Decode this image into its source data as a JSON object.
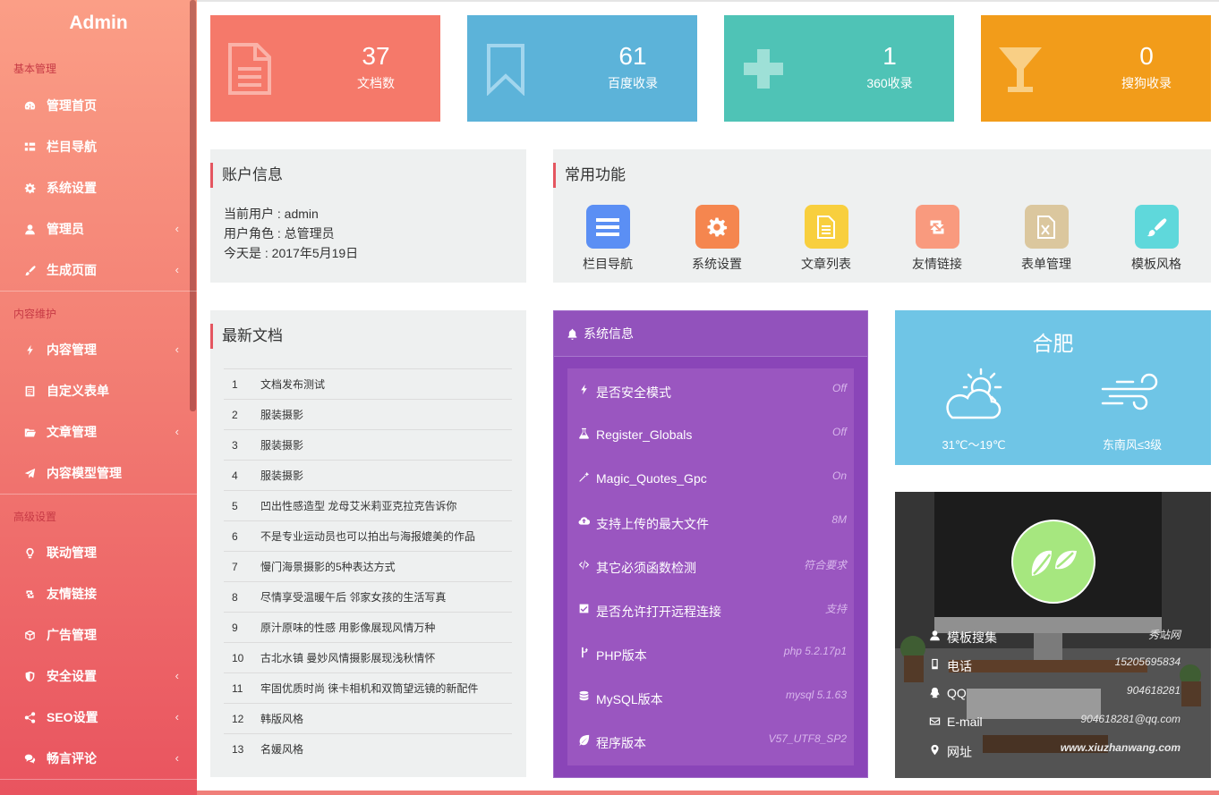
{
  "sidebar": {
    "logo": "Admin",
    "groups": [
      "基本管理",
      "内容维护",
      "高级设置"
    ],
    "items": [
      {
        "label": "管理首页",
        "icon": "dashboard-icon",
        "arrow": ""
      },
      {
        "label": "栏目导航",
        "icon": "list-icon",
        "arrow": ""
      },
      {
        "label": "系统设置",
        "icon": "gear-icon",
        "arrow": ""
      },
      {
        "label": "管理员",
        "icon": "user-icon",
        "arrow": "‹"
      },
      {
        "label": "生成页面",
        "icon": "brush-icon",
        "arrow": "‹"
      },
      {
        "label": "内容管理",
        "icon": "bolt-icon",
        "arrow": "‹"
      },
      {
        "label": "自定义表单",
        "icon": "form-icon",
        "arrow": ""
      },
      {
        "label": "文章管理",
        "icon": "folder-icon",
        "arrow": "‹"
      },
      {
        "label": "内容模型管理",
        "icon": "send-icon",
        "arrow": ""
      },
      {
        "label": "联动管理",
        "icon": "bulb-icon",
        "arrow": ""
      },
      {
        "label": "友情链接",
        "icon": "retweet-icon",
        "arrow": ""
      },
      {
        "label": "广告管理",
        "icon": "cube-icon",
        "arrow": ""
      },
      {
        "label": "安全设置",
        "icon": "shield-icon",
        "arrow": "‹"
      },
      {
        "label": "SEO设置",
        "icon": "share-icon",
        "arrow": "‹"
      },
      {
        "label": "畅言评论",
        "icon": "comments-icon",
        "arrow": "‹"
      }
    ]
  },
  "stats": [
    {
      "value": "37",
      "label": "文档数",
      "color": "#f5796a",
      "icon": "document-icon"
    },
    {
      "value": "61",
      "label": "百度收录",
      "color": "#5cb3d9",
      "icon": "bookmark-icon"
    },
    {
      "value": "1",
      "label": "360收录",
      "color": "#4fc3b6",
      "icon": "plus-icon"
    },
    {
      "value": "0",
      "label": "搜狗收录",
      "color": "#f29c1a",
      "icon": "cocktail-icon"
    }
  ],
  "account": {
    "title": "账户信息",
    "user": "当前用户 : admin",
    "role": "用户角色 : 总管理员",
    "date": "今天是 : 2017年5月19日"
  },
  "quick": {
    "title": "常用功能",
    "items": [
      {
        "label": "栏目导航",
        "color": "#5b8ff4",
        "icon": "list-icon"
      },
      {
        "label": "系统设置",
        "color": "#f5864f",
        "icon": "gear-icon"
      },
      {
        "label": "文章列表",
        "color": "#f8cf3e",
        "icon": "file-icon"
      },
      {
        "label": "友情链接",
        "color": "#f99a7e",
        "icon": "retweet-icon"
      },
      {
        "label": "表单管理",
        "color": "#dbc79e",
        "icon": "excel-icon"
      },
      {
        "label": "模板风格",
        "color": "#5fd8db",
        "icon": "brush-icon"
      }
    ]
  },
  "docs": {
    "title": "最新文档",
    "rows": [
      {
        "n": "1",
        "title": "文档发布测试"
      },
      {
        "n": "2",
        "title": "服装摄影"
      },
      {
        "n": "3",
        "title": "服装摄影"
      },
      {
        "n": "4",
        "title": "服装摄影"
      },
      {
        "n": "5",
        "title": "凹出性感造型 龙母艾米莉亚克拉克告诉你"
      },
      {
        "n": "6",
        "title": "不是专业运动员也可以拍出与海报媲美的作品"
      },
      {
        "n": "7",
        "title": "慢门海景摄影的5种表达方式"
      },
      {
        "n": "8",
        "title": "尽情享受温暖午后 邻家女孩的生活写真"
      },
      {
        "n": "9",
        "title": "原汁原味的性感 用影像展现风情万种"
      },
      {
        "n": "10",
        "title": "古北水镇 曼妙风情摄影展现浅秋情怀"
      },
      {
        "n": "11",
        "title": "牢固优质时尚 徕卡相机和双筒望远镜的新配件"
      },
      {
        "n": "12",
        "title": "韩版风格"
      },
      {
        "n": "13",
        "title": "名媛风格"
      }
    ]
  },
  "sysinfo": {
    "title": "系统信息",
    "items": [
      {
        "label": "是否安全模式",
        "value": "Off",
        "icon": "bolt-icon"
      },
      {
        "label": "Register_Globals",
        "value": "Off",
        "icon": "flask-icon"
      },
      {
        "label": "Magic_Quotes_Gpc",
        "value": "On",
        "icon": "magic-icon"
      },
      {
        "label": "支持上传的最大文件",
        "value": "8M",
        "icon": "cloud-upload-icon"
      },
      {
        "label": "其它必须函数检测",
        "value": "符合要求",
        "icon": "code-icon"
      },
      {
        "label": "是否允许打开远程连接",
        "value": "支持",
        "icon": "checkbox-icon"
      },
      {
        "label": "PHP版本",
        "value": "php 5.2.17p1",
        "icon": "branch-icon"
      },
      {
        "label": "MySQL版本",
        "value": "mysql 5.1.63",
        "icon": "database-icon"
      },
      {
        "label": "程序版本",
        "value": "V57_UTF8_SP2",
        "icon": "leaf-icon"
      }
    ]
  },
  "weather": {
    "city": "合肥",
    "temp": "31℃～19℃",
    "wind": "东南风≤3级",
    "icons": [
      "sun-cloud-icon",
      "wind-icon"
    ]
  },
  "contact": {
    "items": [
      {
        "label": "模板搜集",
        "value": "秀站网",
        "icon": "user-icon"
      },
      {
        "label": "电话",
        "value": "15205695834",
        "icon": "phone-icon"
      },
      {
        "label": "QQ",
        "value": "904618281",
        "icon": "qq-icon"
      },
      {
        "label": "E-mail",
        "value": "904618281@qq.com",
        "icon": "mail-icon"
      },
      {
        "label": "网址",
        "value": "www.xiuzhanwang.com",
        "icon": "location-icon"
      }
    ]
  }
}
